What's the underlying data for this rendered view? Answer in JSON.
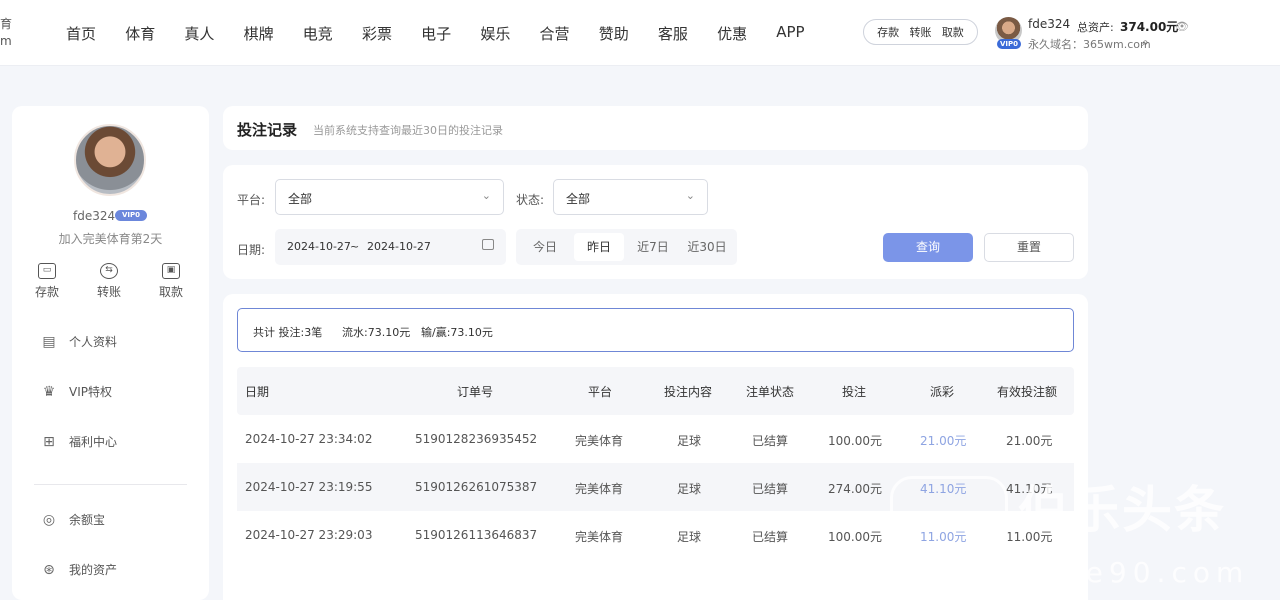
{
  "header": {
    "logo_fragment_top": "育",
    "logo_fragment_bottom": "m",
    "nav": [
      "首页",
      "体育",
      "真人",
      "棋牌",
      "电竞",
      "彩票",
      "电子",
      "娱乐",
      "合营",
      "赞助",
      "客服",
      "优惠",
      "APP"
    ],
    "pill": [
      "存款",
      "转账",
      "取款"
    ],
    "username": "fde324",
    "vip_badge": "VIP0",
    "asset_label": "总资产:",
    "asset_value": "374.00元",
    "domain": "永久域名：365wm.com"
  },
  "sidebar": {
    "username": "fde324",
    "vip_badge": "VIP0",
    "days": "加入完美体育第2天",
    "quick_actions": [
      {
        "label": "存款",
        "icon": "wallet-icon"
      },
      {
        "label": "转账",
        "icon": "transfer-icon"
      },
      {
        "label": "取款",
        "icon": "withdraw-icon"
      }
    ],
    "menu": [
      {
        "label": "个人资料",
        "icon": "id-card-icon"
      },
      {
        "label": "VIP特权",
        "icon": "crown-icon"
      },
      {
        "label": "福利中心",
        "icon": "gift-icon"
      },
      {
        "label": "余额宝",
        "icon": "piggy-bank-icon"
      },
      {
        "label": "我的资产",
        "icon": "assets-icon"
      }
    ]
  },
  "page": {
    "title": "投注记录",
    "subtitle": "当前系统支持查询最近30日的投注记录"
  },
  "filter": {
    "platform_label": "平台:",
    "platform_value": "全部",
    "status_label": "状态:",
    "status_value": "全部",
    "date_label": "日期:",
    "date_from": "2024-10-27",
    "date_sep": "~",
    "date_to": "2024-10-27",
    "quick_ranges": [
      "今日",
      "昨日",
      "近7日",
      "近30日"
    ],
    "active_range": "昨日",
    "query_button": "查询",
    "reset_button": "重置"
  },
  "summary": {
    "total": "共计 投注:3笔",
    "flow": "流水:73.10元",
    "winloss": "输/赢:73.10元"
  },
  "table": {
    "headers": [
      "日期",
      "订单号",
      "平台",
      "投注内容",
      "注单状态",
      "投注",
      "派彩",
      "有效投注额"
    ],
    "rows": [
      [
        "2024-10-27 23:34:02",
        "5190128236935452",
        "完美体育",
        "足球",
        "已结算",
        "100.00元",
        "21.00元",
        "21.00元"
      ],
      [
        "2024-10-27 23:19:55",
        "5190126261075387",
        "完美体育",
        "足球",
        "已结算",
        "274.00元",
        "41.10元",
        "41.10元"
      ],
      [
        "2024-10-27 23:29:03",
        "5190126113646837",
        "完美体育",
        "足球",
        "已结算",
        "100.00元",
        "11.00元",
        "11.00元"
      ]
    ]
  },
  "watermark": {
    "main": "伯乐头条",
    "sub": "bole90.com"
  },
  "colors": {
    "accent": "#7b95e8",
    "summary_border": "#6f87d6",
    "payout_text": "#8ea4e2"
  }
}
